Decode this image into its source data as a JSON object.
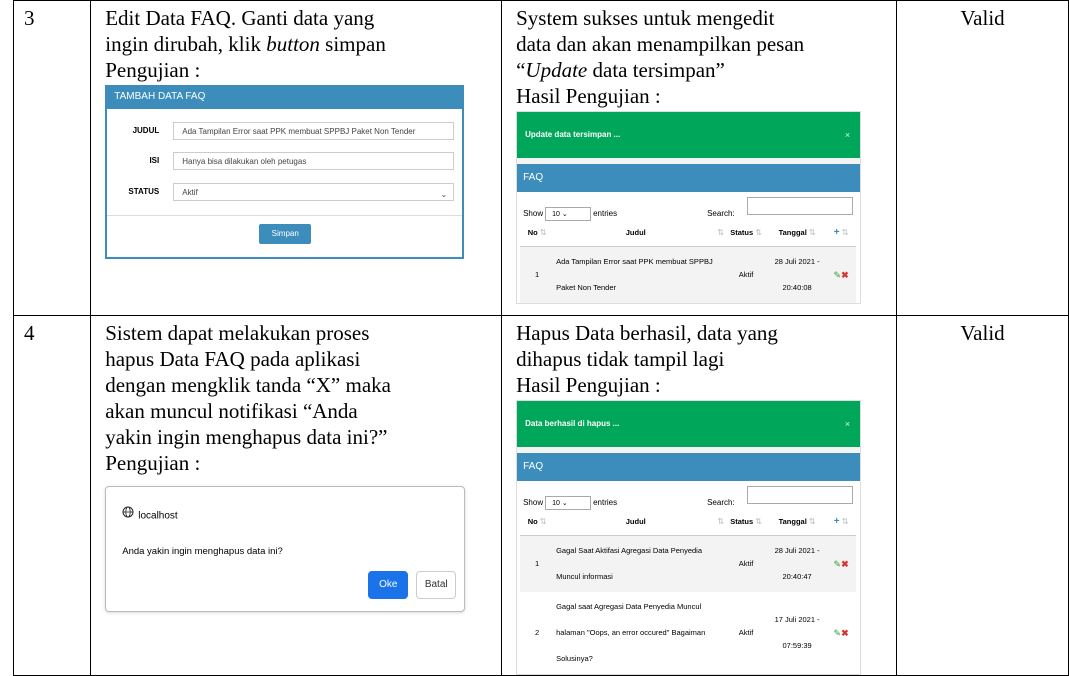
{
  "rows": [
    {
      "no": "3",
      "scenario_lines": [
        "Edit Data FAQ. Ganti data yang",
        "ingin dirubah, klik ",
        "button",
        " simpan",
        "Pengujian :"
      ],
      "result_lines": [
        "System sukses untuk mengedit",
        "data dan akan menampilkan pesan",
        "“",
        "Update",
        " data tersimpan”",
        "Hasil Pengujian :"
      ],
      "status": "Valid"
    },
    {
      "no": "4",
      "scenario_lines": [
        "Sistem dapat melakukan proses",
        "hapus Data FAQ pada aplikasi",
        "dengan mengklik tanda “X” maka",
        "akan muncul notifikasi “Anda",
        "yakin ingin menghapus data ini?”",
        "Pengujian :"
      ],
      "result_lines": [
        "Hapus Data berhasil, data yang",
        "dihapus tidak tampil lagi",
        "Hasil Pengujian :"
      ],
      "status": "Valid"
    }
  ],
  "form": {
    "title": "TAMBAH DATA FAQ",
    "judul_label": "JUDUL",
    "judul_value": "Ada Tampilan Error saat PPK membuat SPPBJ Paket Non Tender",
    "isi_label": "ISI",
    "isi_value": "Hanya bisa dilakukan oleh petugas",
    "status_label": "STATUS",
    "status_value": "Aktif",
    "save_label": "Simpan"
  },
  "faq_update": {
    "alert": "Update data tersimpan ...",
    "close": "×",
    "box_title": "FAQ",
    "show_label": "Show",
    "entries_value": "10",
    "entries_label": "entries",
    "search_label": "Search:",
    "columns": [
      "No",
      "Judul",
      "Status",
      "Tanggal"
    ],
    "rows": [
      {
        "no": "1",
        "judul": "Ada Tampilan Error saat PPK membuat SPPBJ Paket Non Tender",
        "status": "Aktif",
        "tanggal": "28 Juli 2021 - 20:40:08"
      }
    ]
  },
  "faq_delete": {
    "alert": "Data berhasil di hapus ...",
    "close": "×",
    "box_title": "FAQ",
    "show_label": "Show",
    "entries_value": "10",
    "entries_label": "entries",
    "search_label": "Search:",
    "columns": [
      "No",
      "Judul",
      "Status",
      "Tanggal"
    ],
    "rows": [
      {
        "no": "1",
        "judul": "Gagal Saat Aktifasi Agregasi Data Penyedia Muncul informasi",
        "status": "Aktif",
        "tanggal": "28 Juli 2021 - 20:40:47"
      },
      {
        "no": "2",
        "judul": "Gagal saat Agregasi Data Penyedia Muncul halaman \"Oops, an error occured\" Bagaiman Solusinya?",
        "status": "Aktif",
        "tanggal": "17 Juli 2021 - 07:59:39"
      }
    ]
  },
  "dialog": {
    "host": "localhost",
    "message": "Anda yakin ingin menghapus data ini?",
    "ok_label": "Oke",
    "cancel_label": "Batal"
  },
  "icons": {
    "globe": "globe-icon",
    "edit": "pencil-icon",
    "delete": "x-icon",
    "add": "plus-icon",
    "sort": "sort-icon"
  },
  "colors": {
    "primary": "#3c8dbc",
    "success": "#00a65a",
    "dialog_ok": "#1a73e8",
    "danger": "#dd3333"
  }
}
